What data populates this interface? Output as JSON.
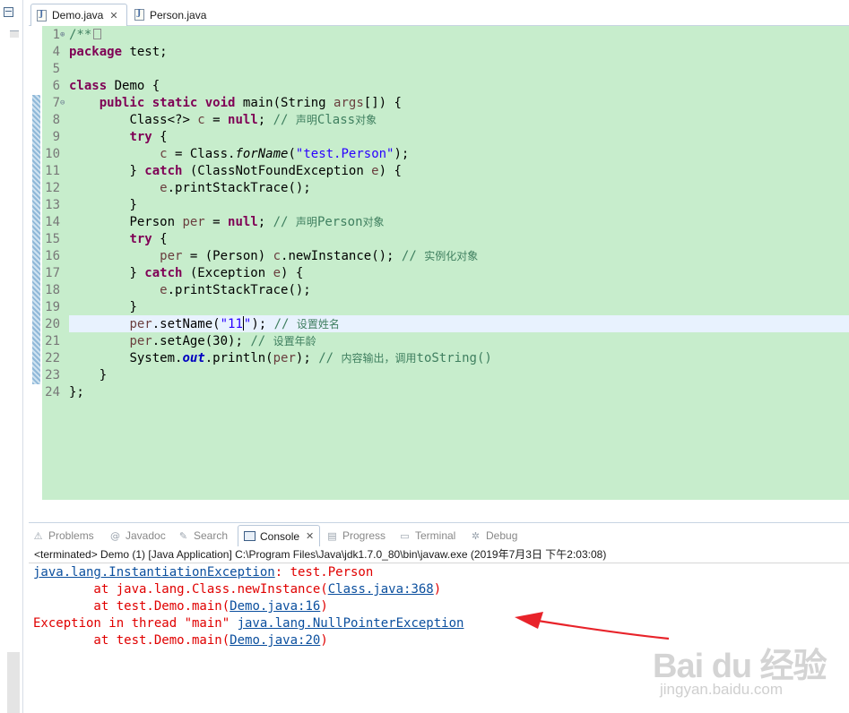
{
  "editor_tabs": [
    {
      "label": "Demo.java",
      "close": "✕"
    },
    {
      "label": "Person.java"
    }
  ],
  "code_lines": [
    {
      "num": "1",
      "fold": "⊕"
    },
    {
      "num": "4"
    },
    {
      "num": "5"
    },
    {
      "num": "6"
    },
    {
      "num": "7",
      "fold": "⊖"
    },
    {
      "num": "8"
    },
    {
      "num": "9"
    },
    {
      "num": "10"
    },
    {
      "num": "11"
    },
    {
      "num": "12"
    },
    {
      "num": "13"
    },
    {
      "num": "14"
    },
    {
      "num": "15"
    },
    {
      "num": "16"
    },
    {
      "num": "17"
    },
    {
      "num": "18"
    },
    {
      "num": "19"
    },
    {
      "num": "20"
    },
    {
      "num": "21"
    },
    {
      "num": "22"
    },
    {
      "num": "23"
    },
    {
      "num": "24"
    }
  ],
  "code": {
    "l1": {
      "text": "/**"
    },
    "l4": {
      "kw": "package",
      "rest": " test;"
    },
    "l6": {
      "kw": "class",
      "rest": " Demo {"
    },
    "l7": {
      "kw1": "public",
      "kw2": "static",
      "kw3": "void",
      "rest": " main(String ",
      "var": "args",
      "end": "[]) {"
    },
    "l8": {
      "a": "Class<?> ",
      "var": "c",
      "b": " = ",
      "kw": "null",
      "c": "; ",
      "cm": "// ",
      "cm_cj": "声明",
      "cm_tail": "Class",
      "cm_cj2": "对象"
    },
    "l9": {
      "kw": "try",
      "rest": " {"
    },
    "l10": {
      "var": "c",
      "a": " = Class.",
      "it": "forName",
      "b": "(",
      "st": "\"test.Person\"",
      "c": ");"
    },
    "l11": {
      "a": "} ",
      "kw": "catch",
      "b": " (ClassNotFoundException ",
      "var": "e",
      "c": ") {"
    },
    "l12": {
      "var": "e",
      "rest": ".printStackTrace();"
    },
    "l13": {
      "text": "}"
    },
    "l14": {
      "a": "Person ",
      "var": "per",
      "b": " = ",
      "kw": "null",
      "c": "; ",
      "cm": "// ",
      "cm_cj": "声明",
      "cm_tail": "Person",
      "cm_cj2": "对象"
    },
    "l15": {
      "kw": "try",
      "rest": " {"
    },
    "l16": {
      "var": "per",
      "a": " = (Person) ",
      "var2": "c",
      "b": ".newInstance(); ",
      "cm": "// ",
      "cm_cj": "实例化对象"
    },
    "l17": {
      "a": "} ",
      "kw": "catch",
      "b": " (Exception ",
      "var": "e",
      "c": ") {"
    },
    "l18": {
      "var": "e",
      "rest": ".printStackTrace();"
    },
    "l19": {
      "text": "}"
    },
    "l20": {
      "var": "per",
      "a": ".setName(",
      "st1": "\"11",
      "st2": "\"",
      "b": "); ",
      "cm": "// ",
      "cm_cj": "设置姓名"
    },
    "l21": {
      "var": "per",
      "a": ".setAge(30); ",
      "cm": "// ",
      "cm_cj": "设置年龄"
    },
    "l22": {
      "a": "System.",
      "fld": "out",
      "b": ".println(",
      "var": "per",
      "c": "); ",
      "cm": "// ",
      "cm_cj": "内容输出，调用",
      "cm_tail": "toString()"
    },
    "l23": {
      "text": "}"
    },
    "l24": {
      "text": "};"
    }
  },
  "view_tabs": [
    {
      "label": "Problems",
      "icon": "problems-icon"
    },
    {
      "label": "Javadoc",
      "icon": "javadoc-icon"
    },
    {
      "label": "Search",
      "icon": "search-icon"
    },
    {
      "label": "Console",
      "icon": "console-icon",
      "active": true,
      "close": "✕"
    },
    {
      "label": "Progress",
      "icon": "progress-icon"
    },
    {
      "label": "Terminal",
      "icon": "terminal-icon"
    },
    {
      "label": "Debug",
      "icon": "debug-icon"
    }
  ],
  "console": {
    "header": "<terminated> Demo (1) [Java Application] C:\\Program Files\\Java\\jdk1.7.0_80\\bin\\javaw.exe (2019年7月3日 下午2:03:08)",
    "lines": [
      {
        "link": "java.lang.InstantiationException",
        "text": ": test.Person"
      },
      {
        "pre": "        at java.lang.Class.newInstance(",
        "link": "Class.java:368",
        "post": ")"
      },
      {
        "pre": "        at test.Demo.main(",
        "link": "Demo.java:16",
        "post": ")"
      },
      {
        "pre": "Exception in thread \"main\" ",
        "link": "java.lang.NullPointerException"
      },
      {
        "pre": "        at test.Demo.main(",
        "link": "Demo.java:20",
        "post": ")"
      }
    ]
  },
  "watermark": {
    "brand": "Bai du 经验",
    "url": "jingyan.baidu.com"
  },
  "colors": {
    "editor_bg": "#c7edcc",
    "keyword": "#7f0055",
    "comment": "#3f7f5f",
    "string": "#2a00ff",
    "console_error": "#e00000",
    "link": "#0b4f9e",
    "arrow": "#e8232a"
  }
}
